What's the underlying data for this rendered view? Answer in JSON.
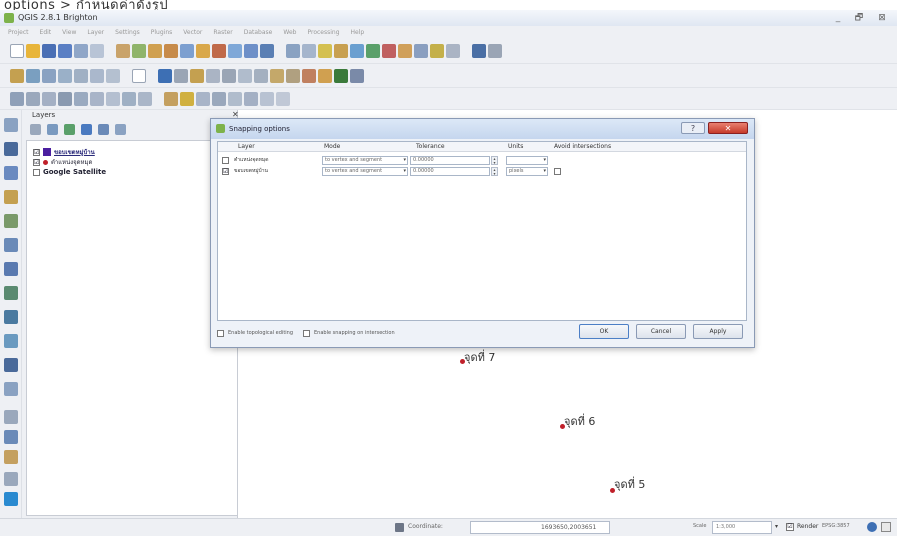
{
  "caption": "options > กำหนดค่าดังรูป",
  "window": {
    "title": "QGIS 2.8.1 Brighton",
    "min": "_",
    "max": "🗗",
    "close": "⊠"
  },
  "menu": [
    "Project",
    "Edit",
    "View",
    "Layer",
    "Settings",
    "Plugins",
    "Vector",
    "Raster",
    "Database",
    "Web",
    "Processing",
    "Help"
  ],
  "layers_panel": {
    "title": "Layers",
    "close": "✕",
    "items": [
      {
        "label": "ขอบเขตหมู่บ้าน",
        "checked": "☑"
      },
      {
        "label": "ตำแหน่งจุดหมุด",
        "checked": "☑"
      },
      {
        "label": "Google Satellite",
        "checked": ""
      }
    ]
  },
  "dialog": {
    "title": "Snapping options",
    "help": "?",
    "close": "✕",
    "columns": [
      "Layer",
      "Mode",
      "Tolerance",
      "Units",
      "Avoid intersections"
    ],
    "rows": [
      {
        "checked": "",
        "layer": "ตำแหน่งจุดหมุด",
        "mode": "to vertex and segment",
        "tolerance": "0.00000",
        "units": "",
        "avoid": ""
      },
      {
        "checked": "☑",
        "layer": "ขอบเขตหมู่บ้าน",
        "mode": "to vertex and segment",
        "tolerance": "0.00000",
        "units": "pixels",
        "avoid": ""
      }
    ],
    "opt_topological": "Enable topological editing",
    "opt_intersection": "Enable snapping on intersection",
    "ok": "OK",
    "cancel": "Cancel",
    "apply": "Apply"
  },
  "map_points": [
    {
      "label": "จุดที่ 7"
    },
    {
      "label": "จุดที่ 6"
    },
    {
      "label": "จุดที่ 5"
    }
  ],
  "statusbar": {
    "coord_label": "Coordinate:",
    "coord_value": "1693650,2003651",
    "scale_label": "Scale",
    "scale_value": "1:3,000",
    "render_checked": "☑",
    "render_label": "Render",
    "epsg": "EPSG:3857"
  },
  "colors": {
    "polygon_layer": "#4b1fa0",
    "point_layer": "#c0202a",
    "dialog_close": "#c63a2a"
  }
}
